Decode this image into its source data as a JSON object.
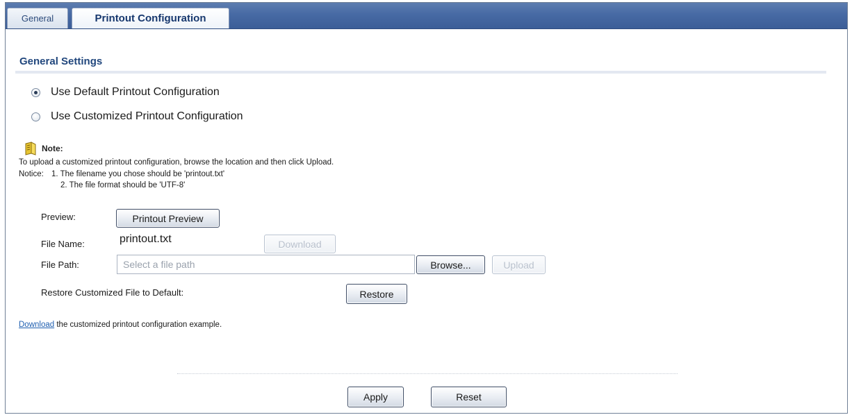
{
  "tabs": [
    {
      "label": "General"
    },
    {
      "label": "Printout Configuration"
    }
  ],
  "section_title": "General Settings",
  "options": [
    {
      "label": "Use Default Printout Configuration",
      "checked": true
    },
    {
      "label": "Use Customized Printout Configuration",
      "checked": false
    }
  ],
  "note": {
    "title": "Note:",
    "line1": "To upload a customized printout configuration, browse the location and then click Upload.",
    "notice_label": "Notice:",
    "item1": "1. The filename you chose should be 'printout.txt'",
    "item2": "2. The file format should be 'UTF-8'"
  },
  "fields": {
    "preview_label": "Preview:",
    "preview_button": "Printout Preview",
    "file_name_label": "File Name:",
    "file_name_value": "printout.txt",
    "download_button": "Download",
    "file_path_label": "File Path:",
    "file_path_placeholder": "Select a file path",
    "browse_button": "Browse...",
    "upload_button": "Upload",
    "restore_label": "Restore Customized File to Default:",
    "restore_button": "Restore"
  },
  "example": {
    "link_text": "Download",
    "rest_text": " the customized printout configuration example."
  },
  "footer": {
    "apply_button": "Apply",
    "reset_button": "Reset"
  }
}
